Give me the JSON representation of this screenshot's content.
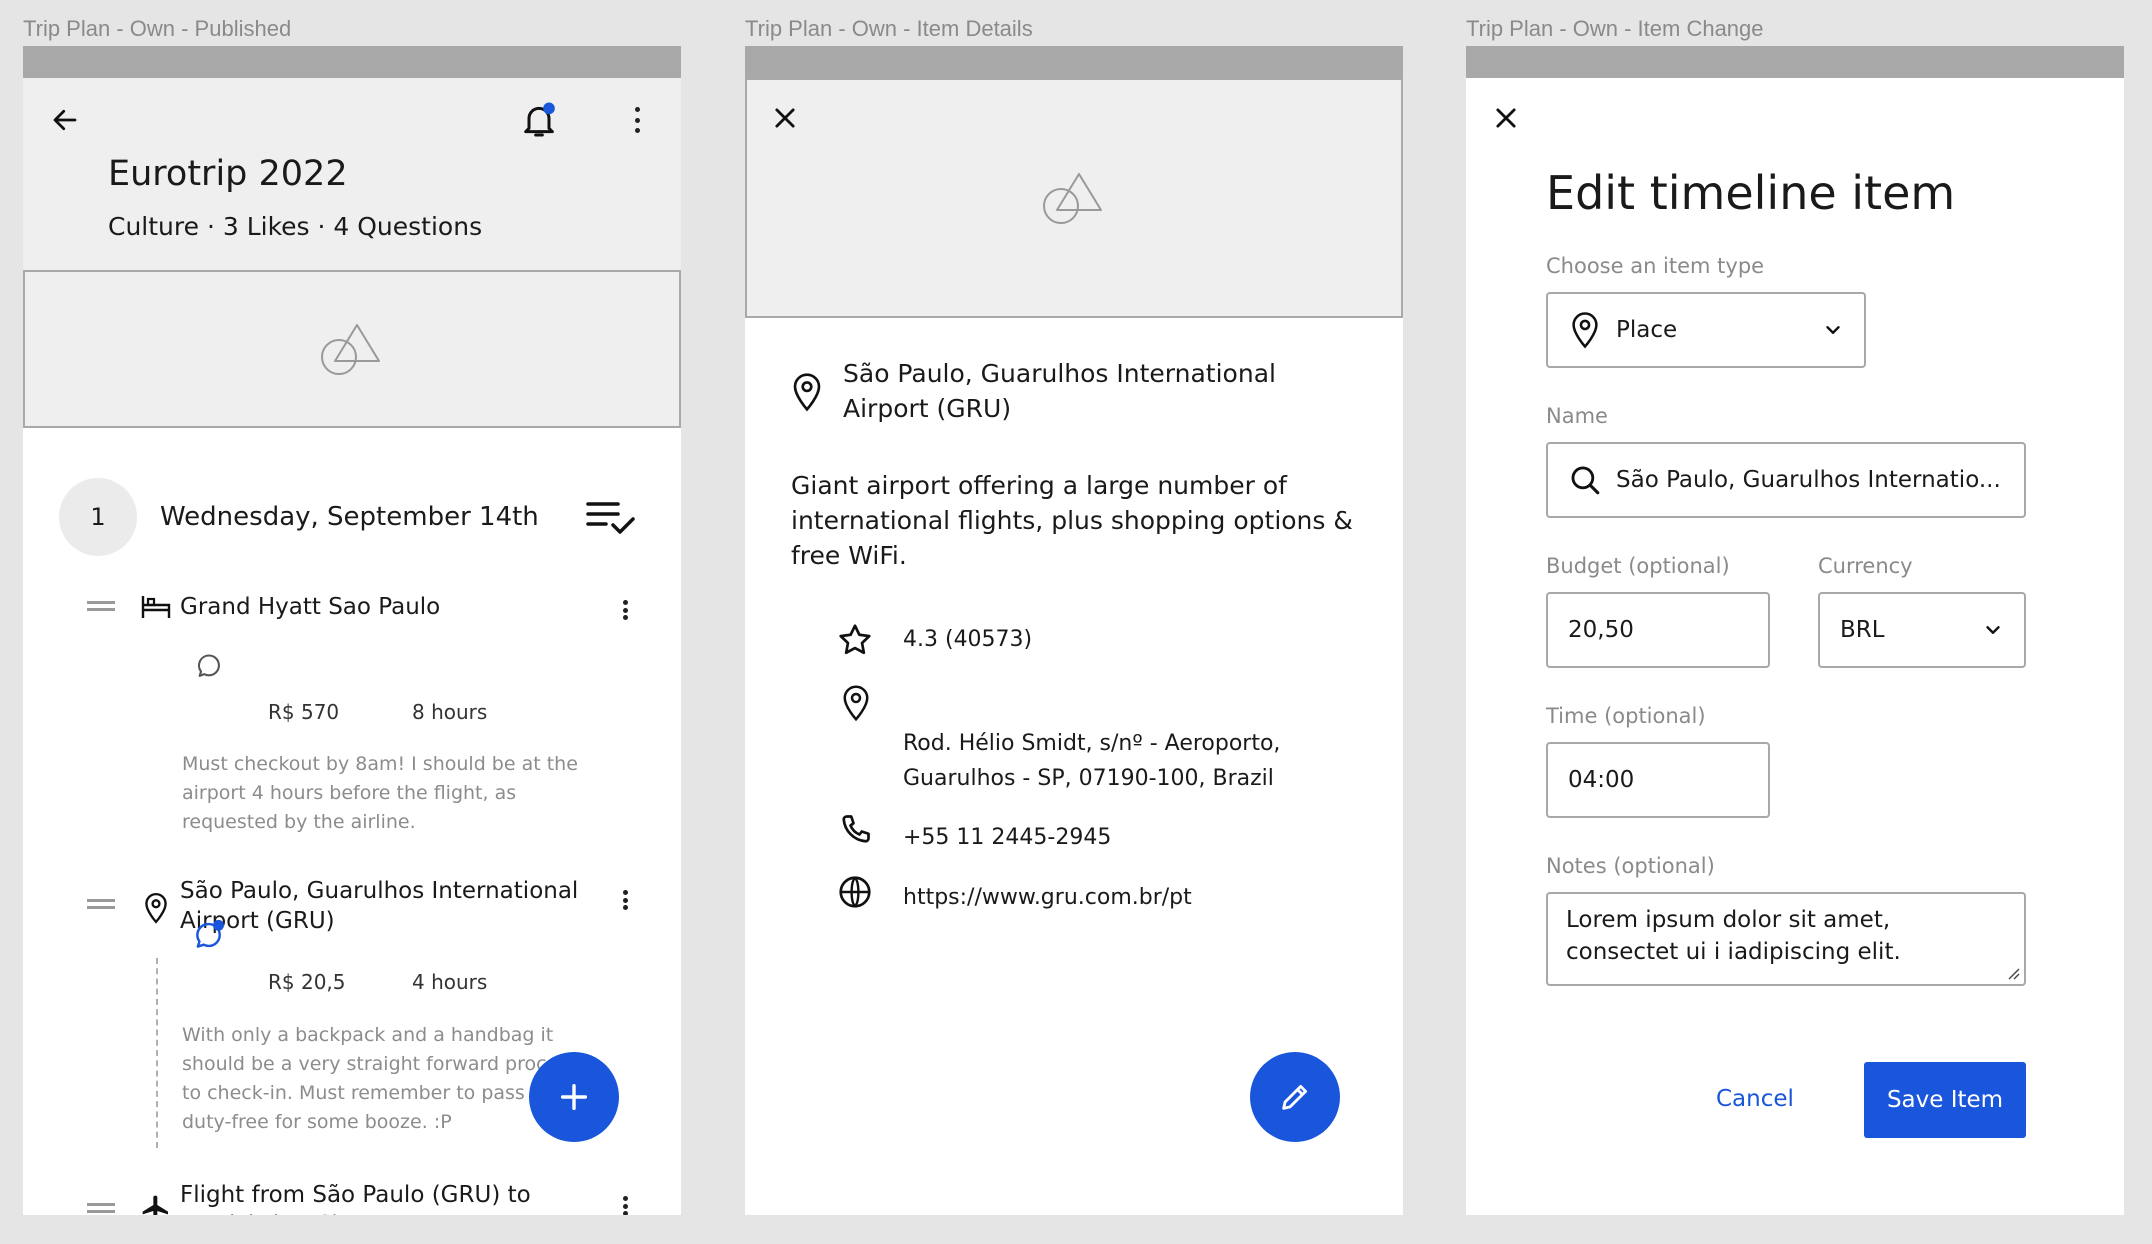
{
  "frames": {
    "published": {
      "label": "Trip Plan - Own - Published",
      "trip_title": "Eurotrip 2022",
      "trip_meta": "Culture · 3 Likes · 4 Questions",
      "day": {
        "number": "1",
        "title": "Wednesday, September 14th"
      },
      "items": [
        {
          "icon": "hotel-icon",
          "name": "Grand Hyatt Sao Paulo",
          "cost": "R$ 570",
          "duration": "8 hours",
          "note": "Must checkout by 8am! I should be at the airport 4 hours before the flight, as requested by the airline."
        },
        {
          "icon": "location-pin-icon",
          "name": "São Paulo, Guarulhos International Airport (GRU)",
          "cost": "R$ 20,5",
          "duration": "4 hours",
          "note": "With only a backpack and a handbag it should be a very straight forward process to check-in. Must remember to pass by the duty-free for some booze. :P"
        },
        {
          "icon": "airplane-icon",
          "name": "Flight from São Paulo (GRU) to Munich (MUC)"
        }
      ],
      "fab": "+"
    },
    "details": {
      "label": "Trip Plan - Own - Item Details",
      "place_name": "São Paulo, Guarulhos International Airport (GRU)",
      "description": "Giant airport offering a large number of international flights, plus shopping options & free WiFi.",
      "rating": "4.3 (40573)",
      "address": "Rod. Hélio Smidt, s/nº - Aeroporto, Guarulhos - SP, 07190-100, Brazil",
      "phone": "+55 11 2445-2945",
      "website": "https://www.gru.com.br/pt"
    },
    "edit": {
      "label": "Trip Plan - Own - Item Change",
      "heading": "Edit timeline item",
      "type_label": "Choose an item type",
      "type_value": "Place",
      "name_label": "Name",
      "name_value": "São Paulo, Guarulhos Internatio...",
      "budget_label": "Budget (optional)",
      "budget_value": "20,50",
      "currency_label": "Currency",
      "currency_value": "BRL",
      "time_label": "Time (optional)",
      "time_value": "04:00",
      "notes_label": "Notes (optional)",
      "notes_value": "Lorem ipsum dolor sit amet, consectet ui i iadipiscing elit.",
      "cancel_label": "Cancel",
      "save_label": "Save Item"
    }
  },
  "colors": {
    "accent": "#1a56db",
    "header_bg": "#efefef",
    "status_bar": "#a8a8a8"
  }
}
